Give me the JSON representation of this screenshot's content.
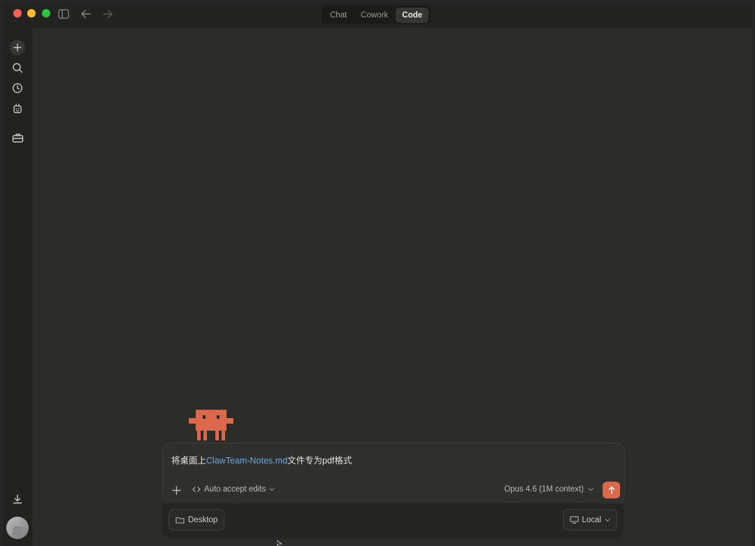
{
  "titlebar": {
    "modes": [
      {
        "label": "Chat",
        "active": false
      },
      {
        "label": "Cowork",
        "active": false
      },
      {
        "label": "Code",
        "active": true
      }
    ]
  },
  "sidebar": {
    "icons": [
      "plus-icon",
      "search-icon",
      "clock-icon",
      "robot-icon",
      "toolbox-icon",
      "download-icon"
    ]
  },
  "composer": {
    "prompt_prefix": "将桌面上",
    "prompt_mention": "ClawTeam-Notes.md",
    "prompt_suffix": "文件专为pdf格式",
    "auto_accept_label": "Auto accept edits",
    "model_label": "Opus 4.6 (1M context)"
  },
  "footer": {
    "folder_label": "Desktop",
    "environment_label": "Local"
  },
  "colors": {
    "accent": "#d9694a",
    "mention": "#6aa8e0",
    "background": "#2b2b29"
  }
}
